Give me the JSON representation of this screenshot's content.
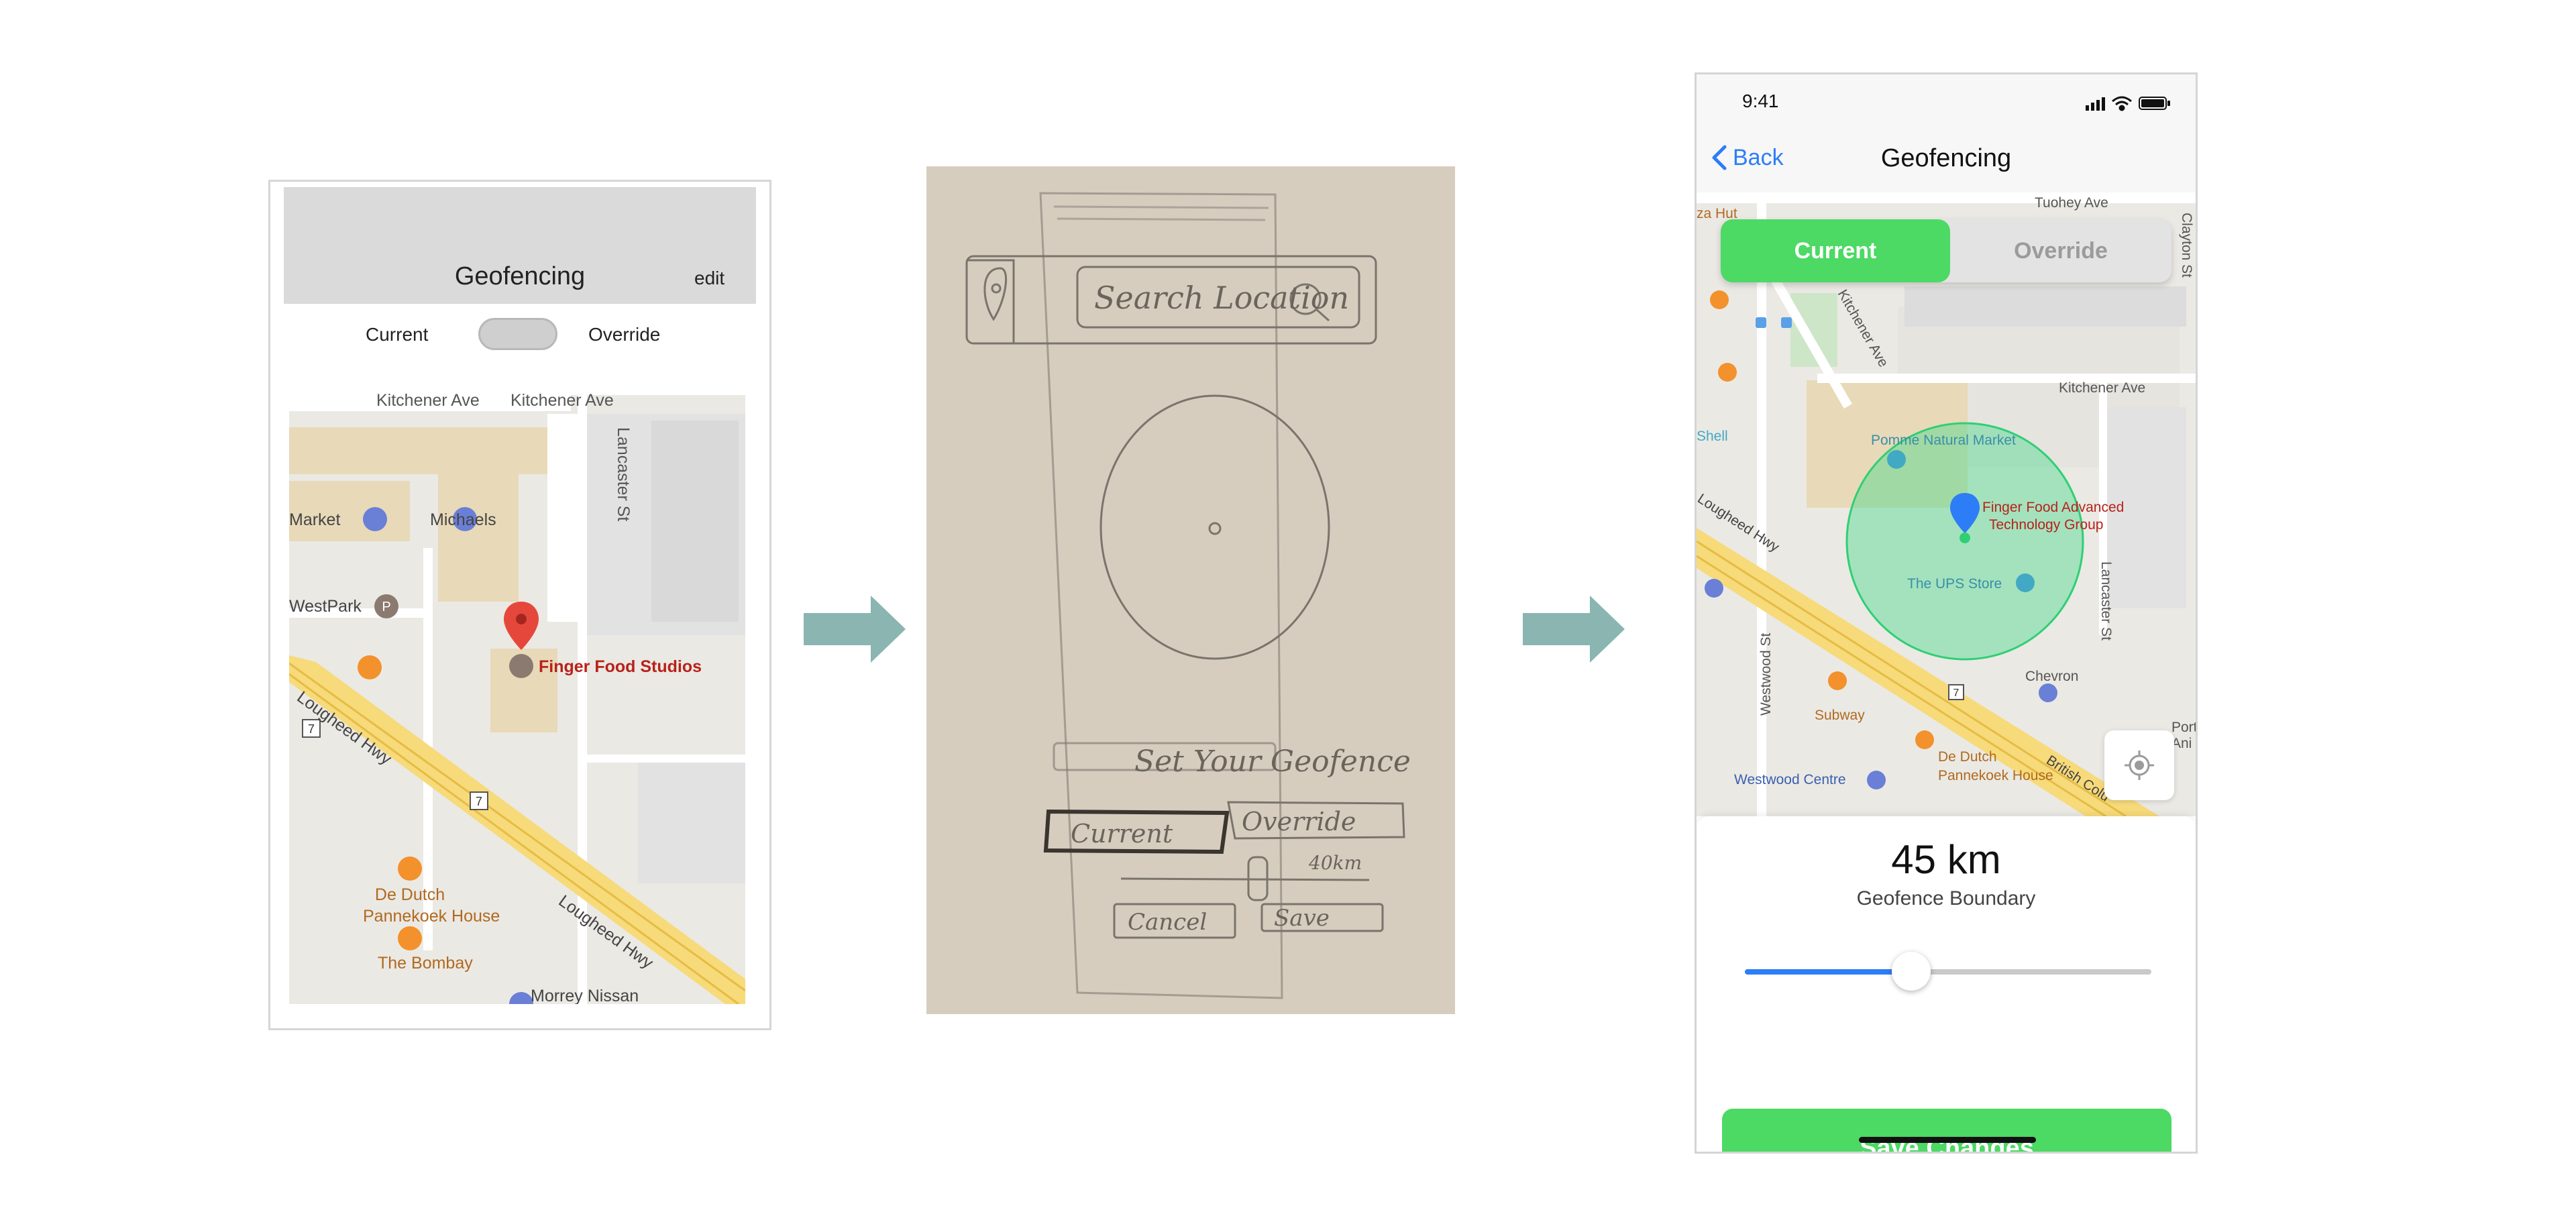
{
  "wireframe": {
    "title": "Geofencing",
    "edit": "edit",
    "current": "Current",
    "override": "Override",
    "map": {
      "streets": [
        "Kitchener Ave",
        "Kitchener Ave",
        "Lancaster St",
        "Lougheed Hwy",
        "Lougheed Hwy"
      ],
      "highway_shields": [
        "7",
        "7"
      ],
      "places": [
        "Market",
        "Michaels",
        "WestPark",
        "Finger Food Studios",
        "De Dutch",
        "Pannekoek House",
        "The Bombay",
        "Morrey Nissan"
      ]
    }
  },
  "sketch": {
    "search": "Search Location",
    "set_label": "Set Your Geofence",
    "current": "Current",
    "override": "Override",
    "distance": "40km",
    "cancel": "Cancel",
    "save": "Save"
  },
  "mockup": {
    "status_time": "9:41",
    "nav": {
      "back": "Back",
      "title": "Geofencing"
    },
    "segments": {
      "current": "Current",
      "override": "Override"
    },
    "map": {
      "streets": [
        "Tuohey Ave",
        "Kitchener Ave",
        "Kitchener Ave",
        "Clayton St",
        "Lougheed Hwy",
        "Westwood St",
        "Lancaster St",
        "British Colu"
      ],
      "highway_shield": "7",
      "places": {
        "shell": "Shell",
        "hut": "za Hut",
        "pomme": "Pomme Natural Market",
        "finger_food_1": "Finger Food Advanced",
        "finger_food_2": "Technology Group",
        "ups": "The UPS Store",
        "chevron": "Chevron",
        "subway": "Subway",
        "de_dutch_1": "De Dutch",
        "de_dutch_2": "Pannekoek House",
        "westwood": "Westwood Centre",
        "port_1": "Port",
        "port_2": "Ani"
      }
    },
    "boundary": {
      "value": "45 km",
      "label": "Geofence Boundary",
      "slider_fraction": 0.41
    },
    "save": "Save Changes"
  },
  "colors": {
    "accent_green": "#4cd964",
    "accent_blue": "#2d7df6",
    "arrow": "#8ab5b1",
    "pin_red": "#e5483b"
  },
  "icons": [
    "map-pin-icon",
    "search-icon",
    "back-chevron-icon",
    "signal-icon",
    "wifi-icon",
    "battery-icon",
    "locate-icon",
    "restaurant-icon",
    "shopping-icon",
    "parking-icon"
  ]
}
